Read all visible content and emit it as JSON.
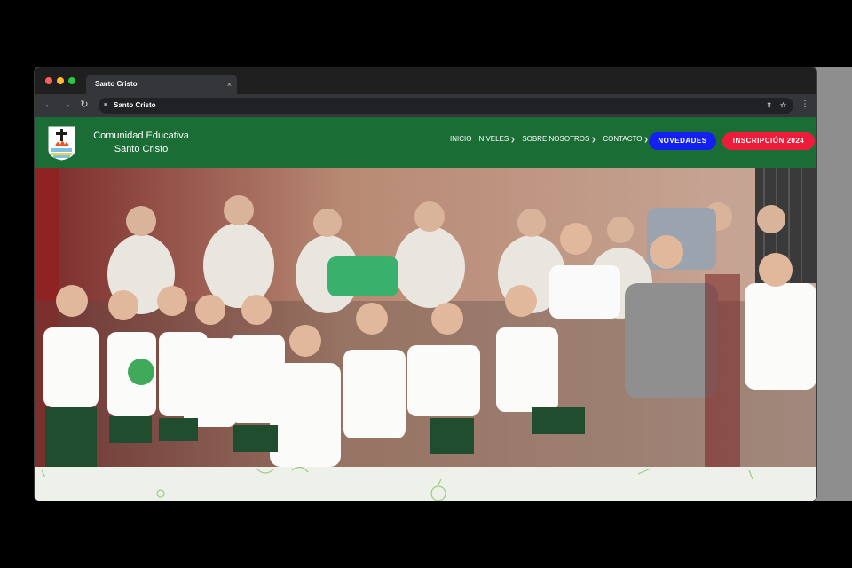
{
  "browser": {
    "tab_title": "Santo Cristo",
    "tab_close": "×",
    "url": "Santo Cristo",
    "icons": [
      "back-icon",
      "forward-icon",
      "reload-icon",
      "lock-icon",
      "share-icon",
      "star-icon",
      "menu-icon"
    ]
  },
  "site": {
    "brand_line1": "Comunidad Educativa",
    "brand_line2": "Santo Cristo",
    "nav": [
      {
        "label": "INICIO",
        "has_dropdown": false
      },
      {
        "label": "NIVELES",
        "has_dropdown": true
      },
      {
        "label": "SOBRE NOSOTROS",
        "has_dropdown": true
      },
      {
        "label": "CONTACTO",
        "has_dropdown": true
      }
    ],
    "btn_novedades": "NOVEDADES",
    "btn_inscripcion": "INSCRIPCIÓN 2024",
    "colors": {
      "header": "#1b6d36",
      "novedades": "#1221f2",
      "inscripcion": "#ee1c3a"
    }
  },
  "hero": {
    "slide_count": 2,
    "active_slide": 1
  }
}
